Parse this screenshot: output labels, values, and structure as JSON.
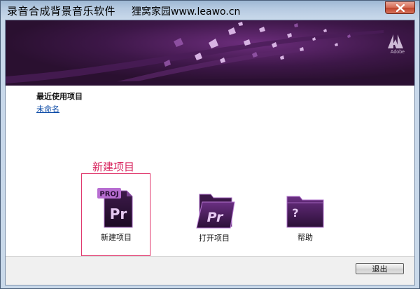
{
  "window": {
    "title": "录音合成背景音乐软件",
    "title_suffix": "狸窝家园www.leawo.cn"
  },
  "banner": {
    "brand": "Adobe"
  },
  "recent": {
    "heading": "最近使用项目",
    "items": [
      "未命名"
    ]
  },
  "annotation": "新建项目",
  "actions": {
    "new_project": {
      "label": "新建项目",
      "badge": "PROJ",
      "glyph": "Pr",
      "icon": "new-project-icon"
    },
    "open_project": {
      "label": "打开项目",
      "glyph": "Pr",
      "icon": "open-folder-icon"
    },
    "help": {
      "label": "帮助",
      "glyph": "?",
      "icon": "help-folder-icon"
    }
  },
  "footer": {
    "exit_label": "退出"
  },
  "colors": {
    "accent_purple": "#6b2b86",
    "annotation_red": "#d7225c",
    "banner_dark": "#2f1437"
  }
}
